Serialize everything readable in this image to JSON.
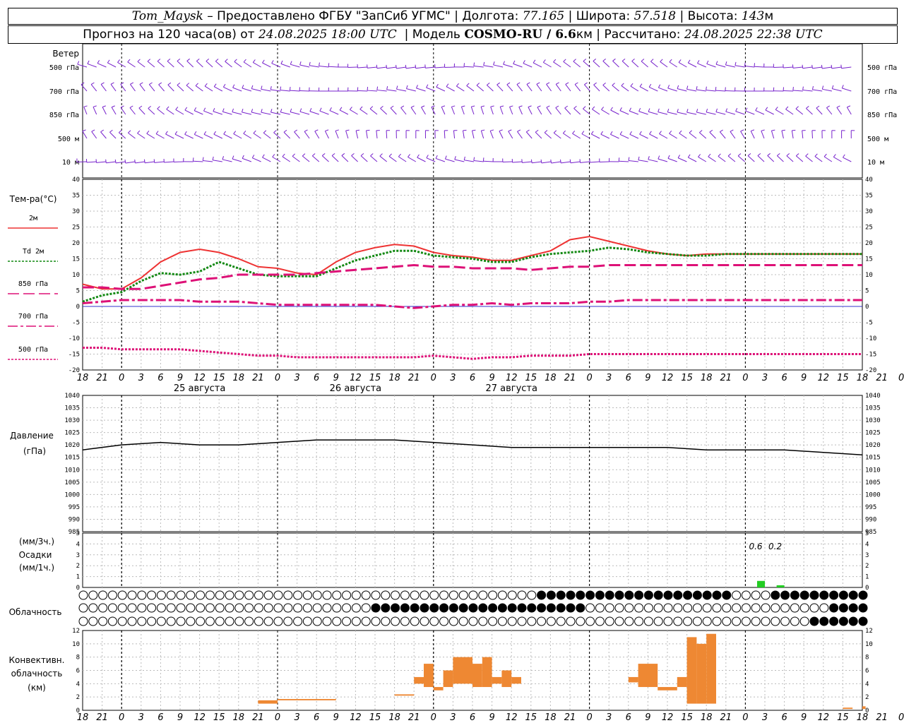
{
  "header": {
    "station": "Tom_Maysk",
    "provider": " – Предоставлено ФГБУ \"ЗапСиб УГМС\" | Долгота: ",
    "lon": "77.165",
    "lat_label": " | Широта: ",
    "lat": "57.518",
    "alt_label": " | Высота: ",
    "alt": "143",
    "alt_unit": "м",
    "forecast_label": "Прогноз на 120 часа(ов) от ",
    "run_time": "24.08.2025 18:00 UTC",
    "model_label": "  | Модель ",
    "model": "COSMO-RU / 6.6",
    "model_unit": "км",
    "calc_label": " | Рассчитано: ",
    "calc_time": "24.08.2025 22:38 UTC"
  },
  "labels": {
    "wind": "Ветер",
    "wind_levels": [
      "500 гПа",
      "700 гПа",
      "850 гПа",
      "500 м",
      "10  м"
    ],
    "temp_title": "Тем-ра(°С)",
    "legend": [
      "2м",
      "Td  2м",
      "850 гПа",
      "700 гПа",
      "500 гПа"
    ],
    "pressure": [
      "Давление",
      "(гПа)"
    ],
    "precip": [
      "(мм/3ч.)",
      "Осадки",
      "(мм/1ч.)"
    ],
    "cloud": "Облачность",
    "conv": [
      "Конвективн.",
      "облачность",
      "(км)"
    ],
    "days": [
      "25 августа",
      "26 августа",
      "27 августа"
    ],
    "precip_values": [
      "0.6",
      "0.2"
    ]
  },
  "colors": {
    "t2m": "#ee3333",
    "td": "#118811",
    "t850": "#dd1177",
    "t700": "#dd1177",
    "t500": "#dd1177",
    "pressure": "#000000",
    "precip": "#22cc22",
    "conv": "#ee8833",
    "wind": "#7722cc"
  },
  "chart_data": [
    {
      "type": "line",
      "title": "Тем-ра(°С)",
      "ylim": [
        -20,
        40
      ],
      "x_hours": [
        0,
        3,
        6,
        9,
        12,
        15,
        18,
        21,
        24,
        27,
        30,
        33,
        36,
        39,
        42,
        45,
        48,
        51,
        54,
        57,
        60,
        63,
        66,
        69,
        72,
        75,
        78,
        81,
        84,
        87,
        90,
        93,
        96,
        99,
        102,
        105,
        108,
        111,
        114,
        117,
        120
      ],
      "x_tick_labels": [
        "18",
        "21",
        "0",
        "3",
        "6",
        "9",
        "12",
        "15",
        "18",
        "21",
        "0",
        "3",
        "6",
        "9",
        "12",
        "15",
        "18",
        "21",
        "0",
        "3",
        "6",
        "9",
        "12",
        "15",
        "18",
        "21",
        "0",
        "3",
        "6",
        "9",
        "12",
        "15",
        "18",
        "21",
        "0",
        "3",
        "6",
        "9",
        "12",
        "15",
        "18",
        "21",
        "0"
      ],
      "series": [
        {
          "name": "2м",
          "values": [
            7,
            5.5,
            5.5,
            9,
            14,
            17,
            18,
            17,
            15,
            12.5,
            12,
            10.5,
            10,
            14,
            17,
            18.5,
            19.5,
            19,
            17,
            16,
            15.5,
            14.5,
            14.5,
            16,
            17.5,
            21,
            22,
            20.5,
            19,
            17.5,
            16.5,
            16,
            16.5,
            16.5,
            16.5,
            16.5,
            16.5,
            16.5,
            16.5,
            16.5,
            16.5
          ]
        },
        {
          "name": "Td  2м",
          "values": [
            1.5,
            3.5,
            4.5,
            8,
            10.5,
            10,
            11,
            14,
            12,
            10,
            9.5,
            9.5,
            9.5,
            12,
            14.5,
            16,
            17.5,
            17.5,
            16,
            15.5,
            15,
            14,
            14,
            15.5,
            16.5,
            17,
            17.5,
            18.5,
            18,
            17,
            16.5,
            16,
            16,
            16.5,
            16.5,
            16.5,
            16.5,
            16.5,
            16.5,
            16.5,
            16.5
          ]
        },
        {
          "name": "850 гПа",
          "values": [
            6,
            6,
            5.5,
            5.5,
            6.5,
            7.5,
            8.5,
            9,
            10,
            10,
            10,
            10,
            10.5,
            11,
            11.5,
            12,
            12.5,
            13,
            12.5,
            12.5,
            12,
            12,
            12,
            11.5,
            12,
            12.5,
            12.5,
            13,
            13,
            13,
            13,
            13,
            13,
            13,
            13,
            13,
            13,
            13,
            13,
            13,
            13
          ]
        },
        {
          "name": "700 гПа",
          "values": [
            1,
            1.5,
            2,
            2,
            2,
            2,
            1.5,
            1.5,
            1.5,
            1,
            0.5,
            0.5,
            0.5,
            0.5,
            0.5,
            0.5,
            0,
            -0.5,
            0,
            0.5,
            0.5,
            1,
            0.5,
            1,
            1,
            1,
            1.5,
            1.5,
            2,
            2,
            2,
            2,
            2,
            2,
            2,
            2,
            2,
            2,
            2,
            2,
            2
          ]
        },
        {
          "name": "500 гПа",
          "values": [
            -13,
            -13,
            -13.5,
            -13.5,
            -13.5,
            -13.5,
            -14,
            -14.5,
            -15,
            -15.5,
            -15.5,
            -16,
            -16,
            -16,
            -16,
            -16,
            -16,
            -16,
            -15.5,
            -16,
            -16.5,
            -16,
            -16,
            -15.5,
            -15.5,
            -15.5,
            -15,
            -15,
            -15,
            -15,
            -15,
            -15,
            -15,
            -15,
            -15,
            -15,
            -15,
            -15,
            -15,
            -15,
            -15
          ]
        }
      ]
    },
    {
      "type": "line",
      "title": "Давление",
      "ylabel": "(гПа)",
      "ylim": [
        985,
        1040
      ],
      "x_hours": [
        0,
        6,
        12,
        18,
        24,
        30,
        36,
        42,
        48,
        54,
        60,
        66,
        72,
        78,
        84,
        90,
        96,
        102,
        108,
        114,
        120
      ],
      "series": [
        {
          "name": "Давление",
          "values": [
            1018,
            1020,
            1021,
            1020,
            1020,
            1021,
            1022,
            1022,
            1022,
            1021,
            1020,
            1019,
            1019,
            1019,
            1019,
            1019,
            1018,
            1018,
            1018,
            1017,
            1016
          ]
        }
      ]
    },
    {
      "type": "bar",
      "title": "Осадки",
      "ylim": [
        0,
        5
      ],
      "x_hours": [
        105,
        108
      ],
      "values": [
        0.6,
        0.2
      ]
    },
    {
      "type": "bar",
      "title": "Конвективн. облачность",
      "ylabel": "(км)",
      "ylim": [
        0,
        12
      ],
      "bars": [
        {
          "x": [
            27,
            30
          ],
          "range": [
            1,
            1.5
          ]
        },
        {
          "x": [
            30,
            39
          ],
          "range": [
            1.5,
            1.7
          ]
        },
        {
          "x": [
            48,
            51
          ],
          "range": [
            2.2,
            2.4
          ]
        },
        {
          "x": [
            51,
            52.5
          ],
          "range": [
            4,
            5
          ]
        },
        {
          "x": [
            52.5,
            54
          ],
          "range": [
            3.5,
            7
          ]
        },
        {
          "x": [
            54,
            55.5
          ],
          "range": [
            3,
            3.5
          ]
        },
        {
          "x": [
            55.5,
            57
          ],
          "range": [
            3.5,
            6
          ]
        },
        {
          "x": [
            57,
            60
          ],
          "range": [
            4,
            8
          ]
        },
        {
          "x": [
            60,
            61.5
          ],
          "range": [
            3.5,
            7
          ]
        },
        {
          "x": [
            61.5,
            63
          ],
          "range": [
            3.5,
            8
          ]
        },
        {
          "x": [
            63,
            64.5
          ],
          "range": [
            4,
            5
          ]
        },
        {
          "x": [
            64.5,
            66
          ],
          "range": [
            3.5,
            6
          ]
        },
        {
          "x": [
            66,
            67.5
          ],
          "range": [
            4,
            5
          ]
        },
        {
          "x": [
            84,
            85.5
          ],
          "range": [
            4.2,
            5
          ]
        },
        {
          "x": [
            85.5,
            88.5
          ],
          "range": [
            3.5,
            7
          ]
        },
        {
          "x": [
            88.5,
            91.5
          ],
          "range": [
            3,
            3.5
          ]
        },
        {
          "x": [
            91.5,
            93
          ],
          "range": [
            3.5,
            5
          ]
        },
        {
          "x": [
            93,
            94.5
          ],
          "range": [
            1,
            11
          ]
        },
        {
          "x": [
            94.5,
            96
          ],
          "range": [
            1,
            10
          ]
        },
        {
          "x": [
            96,
            97.5
          ],
          "range": [
            1,
            11.5
          ]
        },
        {
          "x": [
            117,
            118.5
          ],
          "range": [
            0.2,
            0.4
          ]
        },
        {
          "x": [
            120,
            120.5
          ],
          "range": [
            0.2,
            0.6
          ]
        }
      ]
    }
  ]
}
